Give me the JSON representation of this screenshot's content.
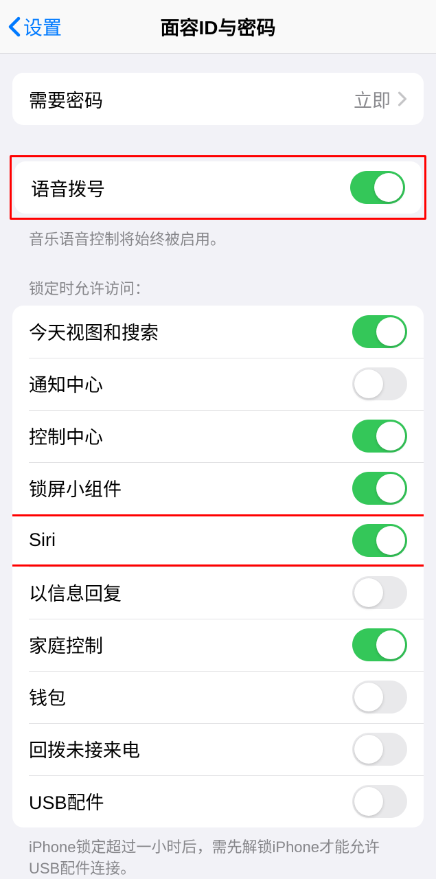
{
  "nav": {
    "back": "设置",
    "title": "面容ID与密码"
  },
  "require_passcode": {
    "label": "需要密码",
    "value": "立即"
  },
  "voice_dial": {
    "label": "语音拨号",
    "footer": "音乐语音控制将始终被启用。"
  },
  "locked_access": {
    "header": "锁定时允许访问：",
    "items": [
      {
        "label": "今天视图和搜索",
        "on": true
      },
      {
        "label": "通知中心",
        "on": false
      },
      {
        "label": "控制中心",
        "on": true
      },
      {
        "label": "锁屏小组件",
        "on": true
      },
      {
        "label": "Siri",
        "on": true
      },
      {
        "label": "以信息回复",
        "on": false
      },
      {
        "label": "家庭控制",
        "on": true
      },
      {
        "label": "钱包",
        "on": false
      },
      {
        "label": "回拨未接来电",
        "on": false
      },
      {
        "label": "USB配件",
        "on": false
      }
    ],
    "footer": "iPhone锁定超过一小时后，需先解锁iPhone才能允许USB配件连接。"
  }
}
